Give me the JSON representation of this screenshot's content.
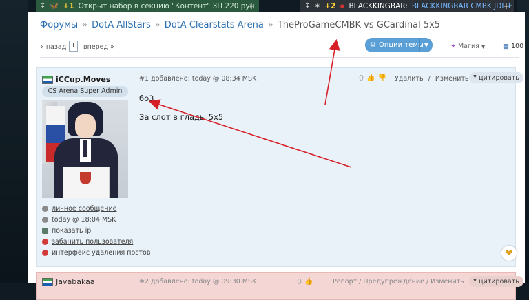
{
  "top_bars": {
    "left": {
      "icon": "butterfly-icon",
      "count": "+1",
      "text": "Открыт набор в секцию \"Контент\" ЗП 220 рун",
      "plus": "+"
    },
    "right": {
      "count": "+2",
      "name": "BLACKKINGBAR:",
      "text": "BLACKKINGBAR CMBK JDITE MNE...",
      "plus": "+"
    }
  },
  "breadcrumb": {
    "items": [
      "Форумы",
      "DotA AllStars",
      "DotA Clearstats Arena"
    ],
    "separator": "»",
    "current": "TheProGameCMBK vs GCardinal 5x5"
  },
  "pager": {
    "prev": "« назад",
    "page": "1",
    "next": "вперед »"
  },
  "topic_options": "Опции темы",
  "magic": "Магия",
  "count": "100",
  "post1": {
    "username": "iCCup.Moves",
    "role": "CS Arena Super Admin",
    "meta": "#1 добавлено: today @ 08:34 MSK",
    "votes": "0",
    "delete": "Удалить",
    "edit": "Изменить",
    "action_sep": "/",
    "quote": "цитировать",
    "line1": "бо3",
    "line2": "За слот в глады 5х5",
    "links": [
      {
        "text": "личное сообщение",
        "icon": "mail-icon",
        "color": "#888888",
        "underline": true
      },
      {
        "text": "today @ 18:04 MSK",
        "icon": "clock-icon",
        "color": "#888888",
        "underline": false
      },
      {
        "text": "показать ip",
        "icon": "monitor-icon",
        "color": "#5a7a6a",
        "underline": false
      },
      {
        "text": "забанить пользователя",
        "icon": "ban-icon",
        "color": "#d23a3a",
        "underline": true
      },
      {
        "text": "интерфейс удаления постов",
        "icon": "delete-icon",
        "color": "#d23a3a",
        "underline": false
      }
    ]
  },
  "post2": {
    "username": "Javabakaa",
    "meta": "#2 добавлено: today @ 09:30 MSK",
    "votes": "0",
    "actions": "Репорт / Предупреждение / Изменить",
    "quote": "цитировать"
  },
  "colors": {
    "accent": "#5a9fd6",
    "link": "#2a6fb2",
    "post_bg": "#e9f2f9",
    "post2_bg": "#f4d6d4",
    "annotation_arrow": "#d61f26"
  }
}
